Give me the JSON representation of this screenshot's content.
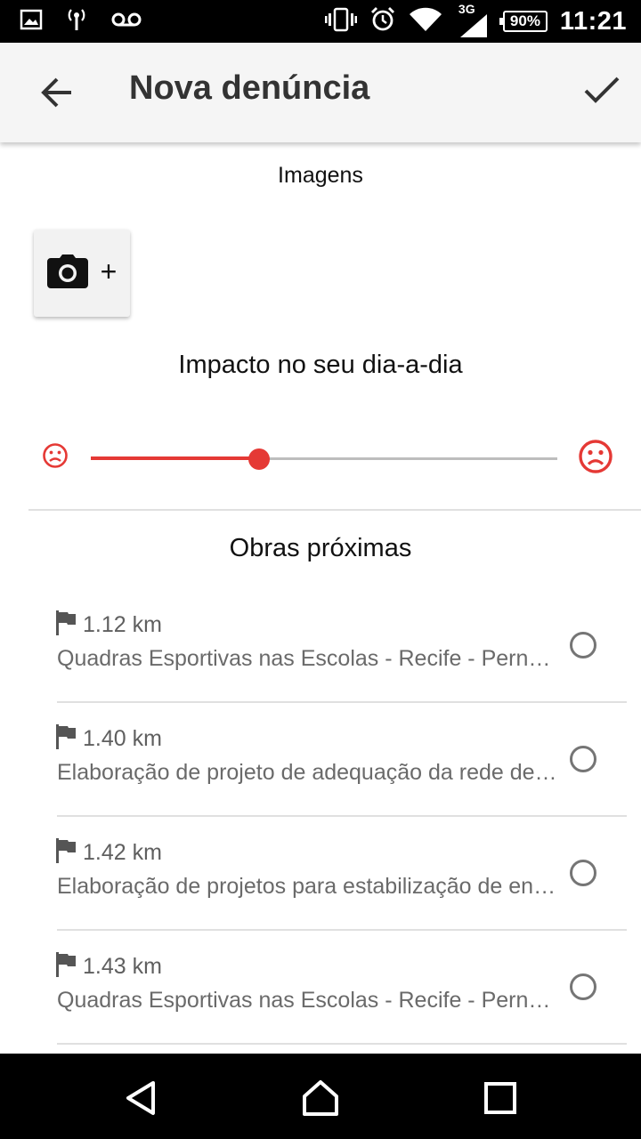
{
  "status_bar": {
    "network": "3G",
    "battery": "90%",
    "time": "11:21",
    "icons": [
      "image-icon",
      "hotspot-icon",
      "voicemail-icon",
      "vibrate-icon",
      "alarm-icon",
      "wifi-icon",
      "signal-icon",
      "battery-icon"
    ]
  },
  "app_bar": {
    "title": "Nova denúncia",
    "back_icon": "arrow-back-icon",
    "confirm_icon": "check-icon"
  },
  "images": {
    "label": "Imagens",
    "add_button": {
      "icon": "camera-icon",
      "plus": "+"
    }
  },
  "impact": {
    "label": "Impacto no seu dia-a-dia",
    "value": 0.36,
    "min_icon": "sad-face-icon",
    "max_icon": "sad-face-icon",
    "accent": "#e53935"
  },
  "obras": {
    "label": "Obras próximas",
    "items": [
      {
        "distance": "1.12 km",
        "name": "Quadras Esportivas nas Escolas - Recife - Pernambuco",
        "selected": false
      },
      {
        "distance": "1.40 km",
        "name": "Elaboração de projeto de adequação da rede de esgoto",
        "selected": false
      },
      {
        "distance": "1.42 km",
        "name": "Elaboração de projetos para estabilização de encostas",
        "selected": false
      },
      {
        "distance": "1.43 km",
        "name": "Quadras Esportivas nas Escolas - Recife - Pernambuco",
        "selected": false
      }
    ]
  },
  "nav_bar": {
    "icons": [
      "back-triangle-icon",
      "home-icon",
      "recents-icon"
    ]
  }
}
